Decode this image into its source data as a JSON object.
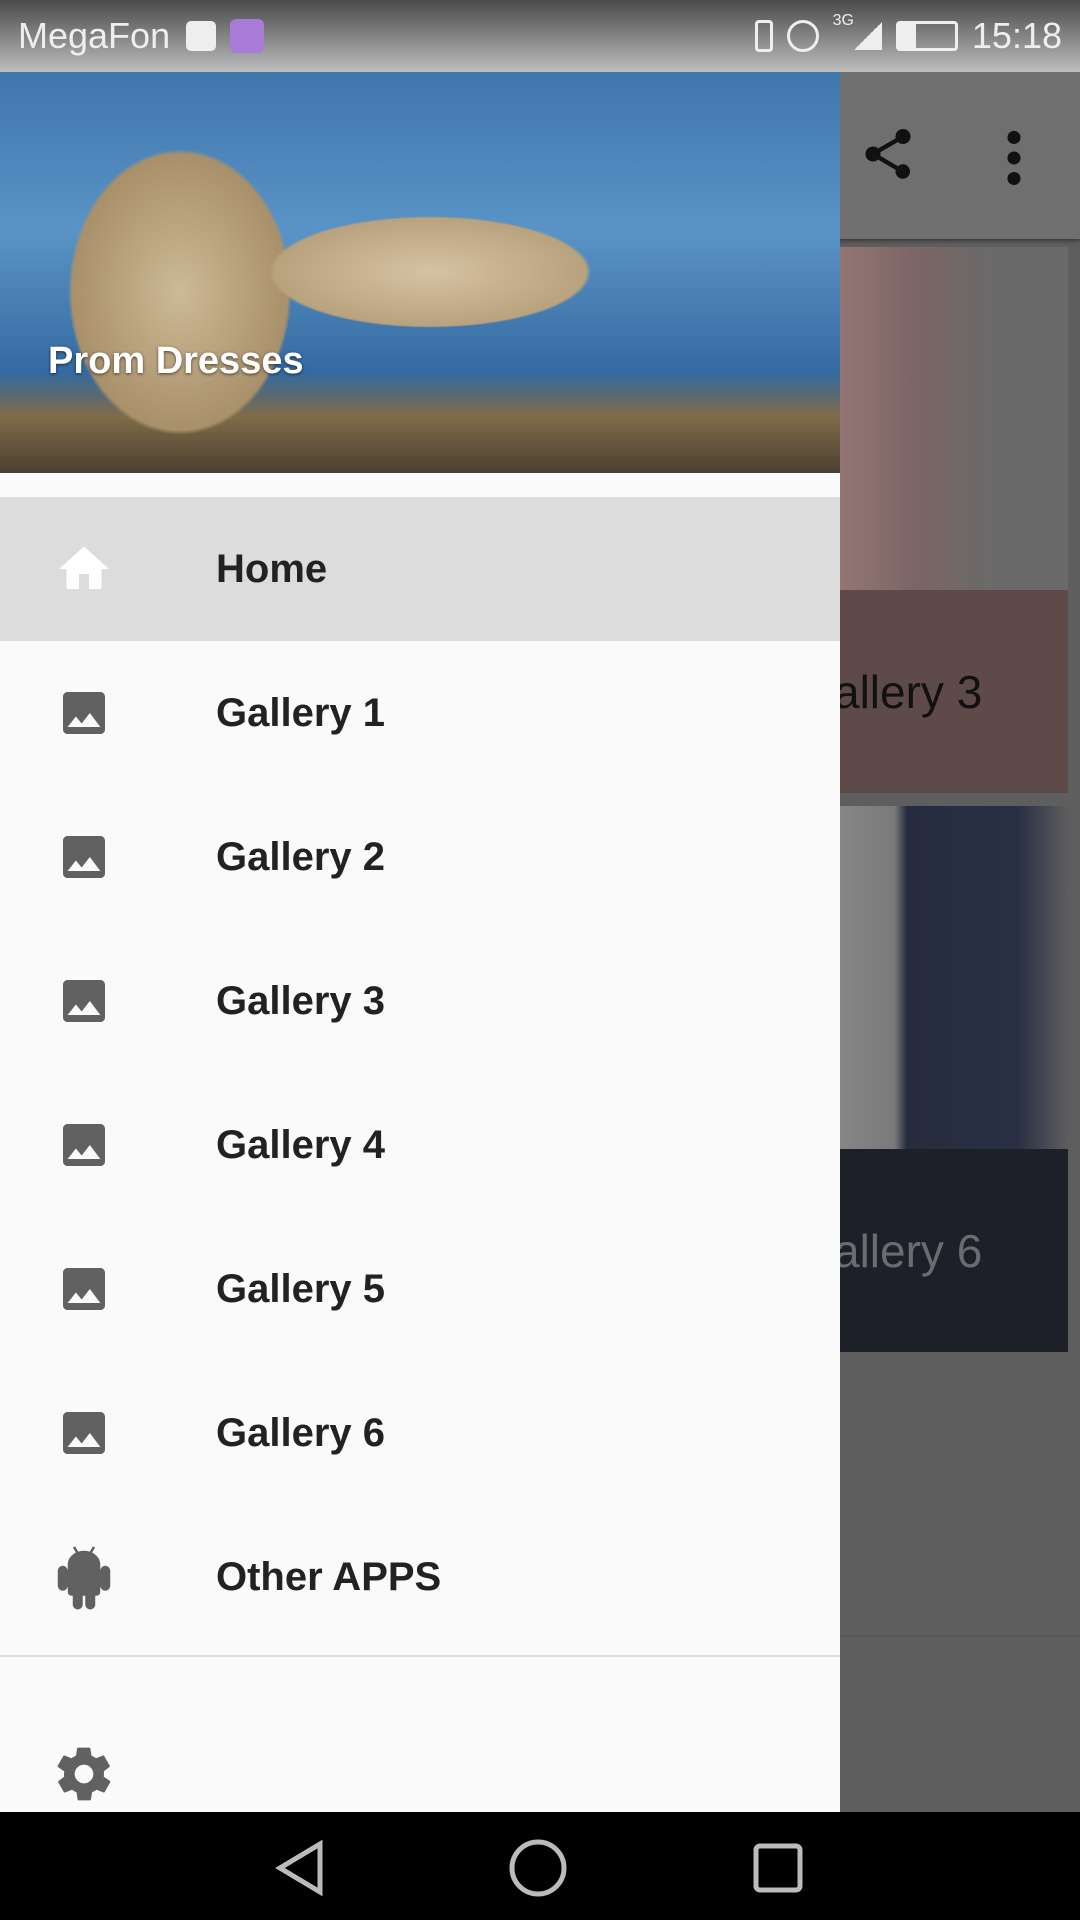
{
  "status_bar": {
    "carrier": "MegaFon",
    "network": "3G",
    "time": "15:18",
    "icons": [
      "sim-card-icon",
      "gallery-notification-icon",
      "vibrate-icon",
      "alarm-icon",
      "signal-icon",
      "battery-icon"
    ]
  },
  "toolbar": {
    "icons": [
      "share-icon",
      "more-vert-icon"
    ]
  },
  "background_cards": [
    {
      "caption": "allery 3",
      "color": "#5e4a48"
    },
    {
      "caption": "allery 6",
      "color": "#1e2029"
    }
  ],
  "drawer": {
    "header_title": "Prom Dresses",
    "items": [
      {
        "label": "Home",
        "icon": "home-icon",
        "active": true
      },
      {
        "label": "Gallery 1",
        "icon": "image-icon"
      },
      {
        "label": "Gallery 2",
        "icon": "image-icon"
      },
      {
        "label": "Gallery 3",
        "icon": "image-icon"
      },
      {
        "label": "Gallery 4",
        "icon": "image-icon"
      },
      {
        "label": "Gallery 5",
        "icon": "image-icon"
      },
      {
        "label": "Gallery 6",
        "icon": "image-icon"
      },
      {
        "label": "Other APPS",
        "icon": "android-icon"
      }
    ],
    "footer_icon": "settings-icon"
  },
  "nav_bar": {
    "icons": [
      "back-icon",
      "home-circle-icon",
      "recents-icon"
    ]
  }
}
